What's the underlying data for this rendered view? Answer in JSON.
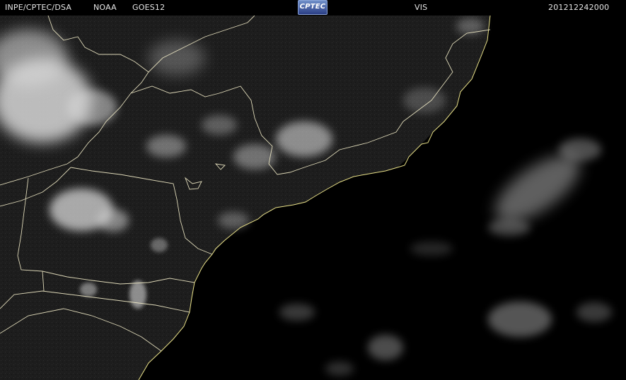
{
  "header": {
    "source": "INPE/CPTEC/DSA",
    "agency": "NOAA",
    "satellite": "GOES12",
    "channel": "VIS",
    "timestamp": "201212242000",
    "logo_text": "CPTEC"
  },
  "map": {
    "channel": "visible",
    "coastline_color": "#e8e088",
    "border_color": "#f2ecc8",
    "land_tone": "#1c1c1c",
    "ocean_tone": "#000000",
    "cloud_color": "#e0e0e0"
  }
}
